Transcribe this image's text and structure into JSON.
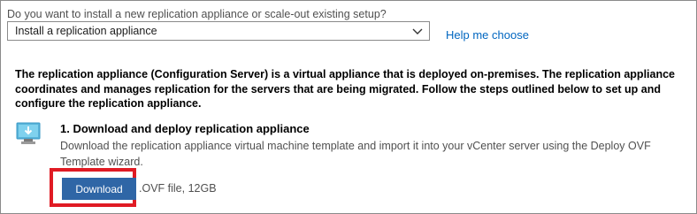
{
  "setup": {
    "question": "Do you want to install a new replication appliance or scale-out existing setup?",
    "selected_option": "Install a replication appliance",
    "help_link": "Help me choose"
  },
  "description": "The replication appliance (Configuration Server) is a virtual appliance that is deployed on-premises. The replication appliance coordinates and manages replication for the servers that are being migrated. Follow the steps outlined below to set up and configure the replication appliance.",
  "step1": {
    "title": "1. Download and deploy replication appliance",
    "description": "Download the replication appliance virtual machine template and import it into your vCenter server using the Deploy OVF Template wizard.",
    "download_label": "Download",
    "file_info": ".OVF file, 12GB"
  },
  "icons": {
    "select_chevron": "chevron-down-icon",
    "step_icon": "vm-download-icon"
  },
  "colors": {
    "link": "#0066c0",
    "button": "#2f66a6",
    "highlight": "#e01b24"
  }
}
